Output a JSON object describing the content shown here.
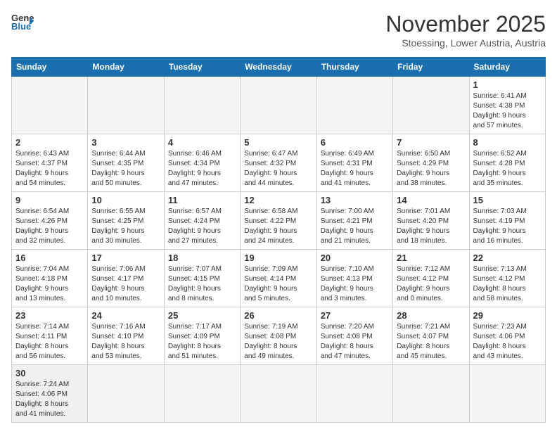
{
  "logo": {
    "line1": "General",
    "line2": "Blue"
  },
  "title": "November 2025",
  "subtitle": "Stoessing, Lower Austria, Austria",
  "weekdays": [
    "Sunday",
    "Monday",
    "Tuesday",
    "Wednesday",
    "Thursday",
    "Friday",
    "Saturday"
  ],
  "weeks": [
    [
      {
        "day": "",
        "info": ""
      },
      {
        "day": "",
        "info": ""
      },
      {
        "day": "",
        "info": ""
      },
      {
        "day": "",
        "info": ""
      },
      {
        "day": "",
        "info": ""
      },
      {
        "day": "",
        "info": ""
      },
      {
        "day": "1",
        "info": "Sunrise: 6:41 AM\nSunset: 4:38 PM\nDaylight: 9 hours\nand 57 minutes."
      }
    ],
    [
      {
        "day": "2",
        "info": "Sunrise: 6:43 AM\nSunset: 4:37 PM\nDaylight: 9 hours\nand 54 minutes."
      },
      {
        "day": "3",
        "info": "Sunrise: 6:44 AM\nSunset: 4:35 PM\nDaylight: 9 hours\nand 50 minutes."
      },
      {
        "day": "4",
        "info": "Sunrise: 6:46 AM\nSunset: 4:34 PM\nDaylight: 9 hours\nand 47 minutes."
      },
      {
        "day": "5",
        "info": "Sunrise: 6:47 AM\nSunset: 4:32 PM\nDaylight: 9 hours\nand 44 minutes."
      },
      {
        "day": "6",
        "info": "Sunrise: 6:49 AM\nSunset: 4:31 PM\nDaylight: 9 hours\nand 41 minutes."
      },
      {
        "day": "7",
        "info": "Sunrise: 6:50 AM\nSunset: 4:29 PM\nDaylight: 9 hours\nand 38 minutes."
      },
      {
        "day": "8",
        "info": "Sunrise: 6:52 AM\nSunset: 4:28 PM\nDaylight: 9 hours\nand 35 minutes."
      }
    ],
    [
      {
        "day": "9",
        "info": "Sunrise: 6:54 AM\nSunset: 4:26 PM\nDaylight: 9 hours\nand 32 minutes."
      },
      {
        "day": "10",
        "info": "Sunrise: 6:55 AM\nSunset: 4:25 PM\nDaylight: 9 hours\nand 30 minutes."
      },
      {
        "day": "11",
        "info": "Sunrise: 6:57 AM\nSunset: 4:24 PM\nDaylight: 9 hours\nand 27 minutes."
      },
      {
        "day": "12",
        "info": "Sunrise: 6:58 AM\nSunset: 4:22 PM\nDaylight: 9 hours\nand 24 minutes."
      },
      {
        "day": "13",
        "info": "Sunrise: 7:00 AM\nSunset: 4:21 PM\nDaylight: 9 hours\nand 21 minutes."
      },
      {
        "day": "14",
        "info": "Sunrise: 7:01 AM\nSunset: 4:20 PM\nDaylight: 9 hours\nand 18 minutes."
      },
      {
        "day": "15",
        "info": "Sunrise: 7:03 AM\nSunset: 4:19 PM\nDaylight: 9 hours\nand 16 minutes."
      }
    ],
    [
      {
        "day": "16",
        "info": "Sunrise: 7:04 AM\nSunset: 4:18 PM\nDaylight: 9 hours\nand 13 minutes."
      },
      {
        "day": "17",
        "info": "Sunrise: 7:06 AM\nSunset: 4:17 PM\nDaylight: 9 hours\nand 10 minutes."
      },
      {
        "day": "18",
        "info": "Sunrise: 7:07 AM\nSunset: 4:15 PM\nDaylight: 9 hours\nand 8 minutes."
      },
      {
        "day": "19",
        "info": "Sunrise: 7:09 AM\nSunset: 4:14 PM\nDaylight: 9 hours\nand 5 minutes."
      },
      {
        "day": "20",
        "info": "Sunrise: 7:10 AM\nSunset: 4:13 PM\nDaylight: 9 hours\nand 3 minutes."
      },
      {
        "day": "21",
        "info": "Sunrise: 7:12 AM\nSunset: 4:12 PM\nDaylight: 9 hours\nand 0 minutes."
      },
      {
        "day": "22",
        "info": "Sunrise: 7:13 AM\nSunset: 4:12 PM\nDaylight: 8 hours\nand 58 minutes."
      }
    ],
    [
      {
        "day": "23",
        "info": "Sunrise: 7:14 AM\nSunset: 4:11 PM\nDaylight: 8 hours\nand 56 minutes."
      },
      {
        "day": "24",
        "info": "Sunrise: 7:16 AM\nSunset: 4:10 PM\nDaylight: 8 hours\nand 53 minutes."
      },
      {
        "day": "25",
        "info": "Sunrise: 7:17 AM\nSunset: 4:09 PM\nDaylight: 8 hours\nand 51 minutes."
      },
      {
        "day": "26",
        "info": "Sunrise: 7:19 AM\nSunset: 4:08 PM\nDaylight: 8 hours\nand 49 minutes."
      },
      {
        "day": "27",
        "info": "Sunrise: 7:20 AM\nSunset: 4:08 PM\nDaylight: 8 hours\nand 47 minutes."
      },
      {
        "day": "28",
        "info": "Sunrise: 7:21 AM\nSunset: 4:07 PM\nDaylight: 8 hours\nand 45 minutes."
      },
      {
        "day": "29",
        "info": "Sunrise: 7:23 AM\nSunset: 4:06 PM\nDaylight: 8 hours\nand 43 minutes."
      }
    ],
    [
      {
        "day": "30",
        "info": "Sunrise: 7:24 AM\nSunset: 4:06 PM\nDaylight: 8 hours\nand 41 minutes."
      },
      {
        "day": "",
        "info": ""
      },
      {
        "day": "",
        "info": ""
      },
      {
        "day": "",
        "info": ""
      },
      {
        "day": "",
        "info": ""
      },
      {
        "day": "",
        "info": ""
      },
      {
        "day": "",
        "info": ""
      }
    ]
  ]
}
